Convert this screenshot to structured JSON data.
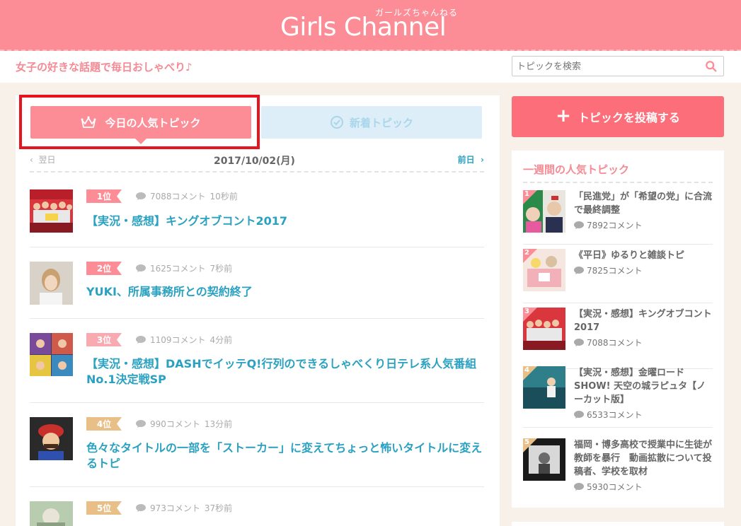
{
  "header": {
    "logo": "Girls Channel",
    "logo_ruby": "ガールズちゃんねる",
    "tagline": "女子の好きな話題で毎日おしゃべり♪",
    "search_placeholder": "トピックを検索"
  },
  "tabs": {
    "today": "今日の人気トピック",
    "new": "新着トピック"
  },
  "datebar": {
    "prev": "翌日",
    "date": "2017/10/02(月)",
    "next": "前日"
  },
  "topics": [
    {
      "rank": "1位",
      "comments": "7088コメント",
      "time": "10秒前",
      "title": "【実況・感想】キングオブコント2017"
    },
    {
      "rank": "2位",
      "comments": "1625コメント",
      "time": "7秒前",
      "title": "YUKI、所属事務所との契約終了"
    },
    {
      "rank": "3位",
      "comments": "1109コメント",
      "time": "4分前",
      "title": "【実況・感想】DASHでイッテQ!行列のできるしゃべくり日テレ系人気番組No.1決定戦SP"
    },
    {
      "rank": "4位",
      "comments": "990コメント",
      "time": "13分前",
      "title": "色々なタイトルの一部を「ストーカー」に変えてちょっと怖いタイトルに変えるトピ"
    },
    {
      "rank": "5位",
      "comments": "973コメント",
      "time": "37秒前",
      "title": ""
    }
  ],
  "colors": {
    "rank_pink": "#fc8d97",
    "rank_light": "#f9a9b0",
    "rank_gold": "#e8bf86"
  },
  "sidebar": {
    "post_button": "トピックを投稿する",
    "weekly_title": "一週間の人気トピック",
    "weekly": [
      {
        "rank": "1",
        "title": "「民進党」が「希望の党」に合流で最終調整",
        "comments": "7892コメント"
      },
      {
        "rank": "2",
        "title": "《平日》ゆるりと雑談トピ",
        "comments": "7825コメント"
      },
      {
        "rank": "3",
        "title": "【実況・感想】キングオブコント2017",
        "comments": "7088コメント"
      },
      {
        "rank": "4",
        "title": "【実況・感想】金曜ロードSHOW! 天空の城ラピュタ【ノーカット版】",
        "comments": "6533コメント"
      },
      {
        "rank": "5",
        "title": "福岡・博多高校で授業中に生徒が教師を暴行　動画拡散について投稿者、学校を取材",
        "comments": "5930コメント"
      }
    ]
  }
}
